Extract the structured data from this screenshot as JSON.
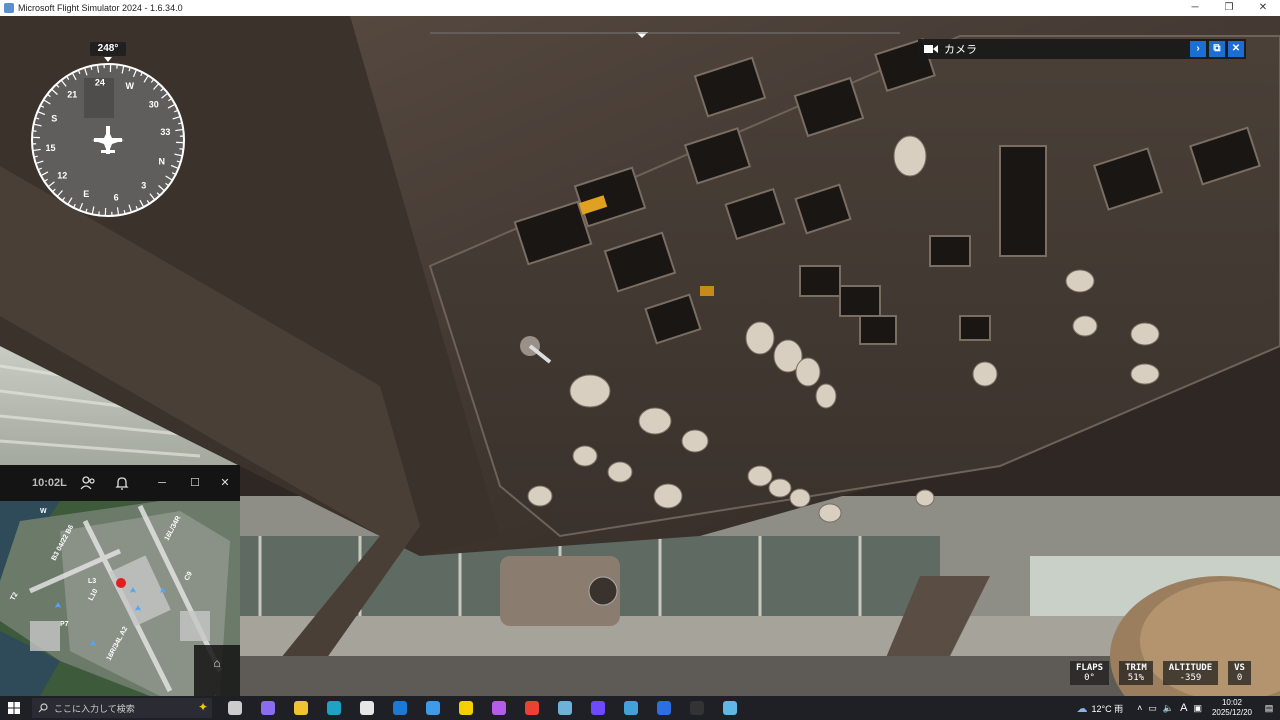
{
  "window": {
    "title": "Microsoft Flight Simulator 2024 - 1.6.34.0",
    "minimize": "─",
    "restore": "❐",
    "close": "✕"
  },
  "compass": {
    "heading": "248°",
    "labels": [
      "24",
      "W",
      "30",
      "33",
      "N",
      "3",
      "6",
      "E",
      "12",
      "15",
      "S",
      "21"
    ]
  },
  "camera_panel": {
    "title": "カメラ",
    "expand": "›",
    "popout": "⧉",
    "close": "✕"
  },
  "map_panel": {
    "time": "10:02L",
    "minimize": "─",
    "maximize": "☐",
    "close": "✕",
    "labels": [
      "W",
      "16L/34R",
      "C9",
      "L10",
      "B3 04/22 B6",
      "16R/34L A2",
      "P7",
      "L3",
      "T2"
    ],
    "tools": [
      "⌂",
      "≋"
    ]
  },
  "readouts": [
    {
      "label": "FLAPS",
      "value": "0°"
    },
    {
      "label": "TRIM",
      "value": "51%"
    },
    {
      "label": "ALTITUDE",
      "value": "-359"
    },
    {
      "label": "VS",
      "value": "0"
    }
  ],
  "taskbar": {
    "search_placeholder": "ここに入力して検索",
    "weather": "12°C 雨",
    "ime": "A",
    "time": "10:02",
    "date": "2025/12/20",
    "apps": [
      {
        "name": "task-view",
        "color": "#cccccc"
      },
      {
        "name": "copilot",
        "color": "#8a6cf0"
      },
      {
        "name": "explorer",
        "color": "#f1c232"
      },
      {
        "name": "edge",
        "color": "#1fa3c4"
      },
      {
        "name": "store",
        "color": "#e6e6e6"
      },
      {
        "name": "outlook",
        "color": "#1b7bd4"
      },
      {
        "name": "photos",
        "color": "#3d9be9"
      },
      {
        "name": "sticky",
        "color": "#f4d000"
      },
      {
        "name": "copilot-2",
        "color": "#b45ee8"
      },
      {
        "name": "chrome",
        "color": "#e94235"
      },
      {
        "name": "msfs",
        "color": "#6db3d8"
      },
      {
        "name": "proton",
        "color": "#6d4aff"
      },
      {
        "name": "globe",
        "color": "#44a0d8"
      },
      {
        "name": "books",
        "color": "#2c6fe0"
      },
      {
        "name": "recorder",
        "color": "#333333"
      },
      {
        "name": "msfs-2",
        "color": "#5fb7e5"
      }
    ]
  }
}
